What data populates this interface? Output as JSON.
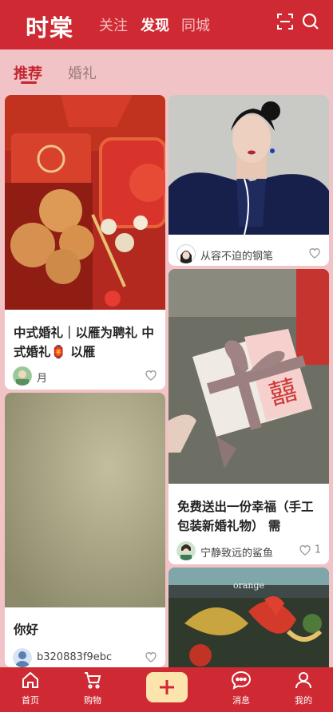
{
  "header": {
    "logo": "时棠",
    "tabs": [
      {
        "label": "关注"
      },
      {
        "label": "发现"
      },
      {
        "label": "同城"
      }
    ]
  },
  "subtabs": [
    {
      "label": "推荐"
    },
    {
      "label": "婚礼"
    }
  ],
  "feed": [
    {
      "title": "中式婚礼｜以雁为聘礼 中式婚礼🏮 以雁",
      "author": "月",
      "likes": ""
    },
    {
      "title": "你好",
      "author": "b320883f9ebc",
      "likes": ""
    },
    {
      "title": "",
      "author": "从容不迫的钢笔",
      "likes": ""
    },
    {
      "title": "免费送出一份幸福（手工包装新婚礼物） 需",
      "author": "宁静致远的鲨鱼",
      "likes": "1"
    },
    {
      "image_text": "orange"
    }
  ],
  "bottom_nav": [
    {
      "label": "首页",
      "icon": "home-icon"
    },
    {
      "label": "购物",
      "icon": "cart-icon"
    },
    {
      "label": "",
      "icon": "plus-icon"
    },
    {
      "label": "消息",
      "icon": "chat-icon"
    },
    {
      "label": "我的",
      "icon": "person-icon"
    }
  ],
  "colors": {
    "brand": "#cf2a33",
    "background": "#f2c3c6",
    "accent": "#fde3ac"
  }
}
